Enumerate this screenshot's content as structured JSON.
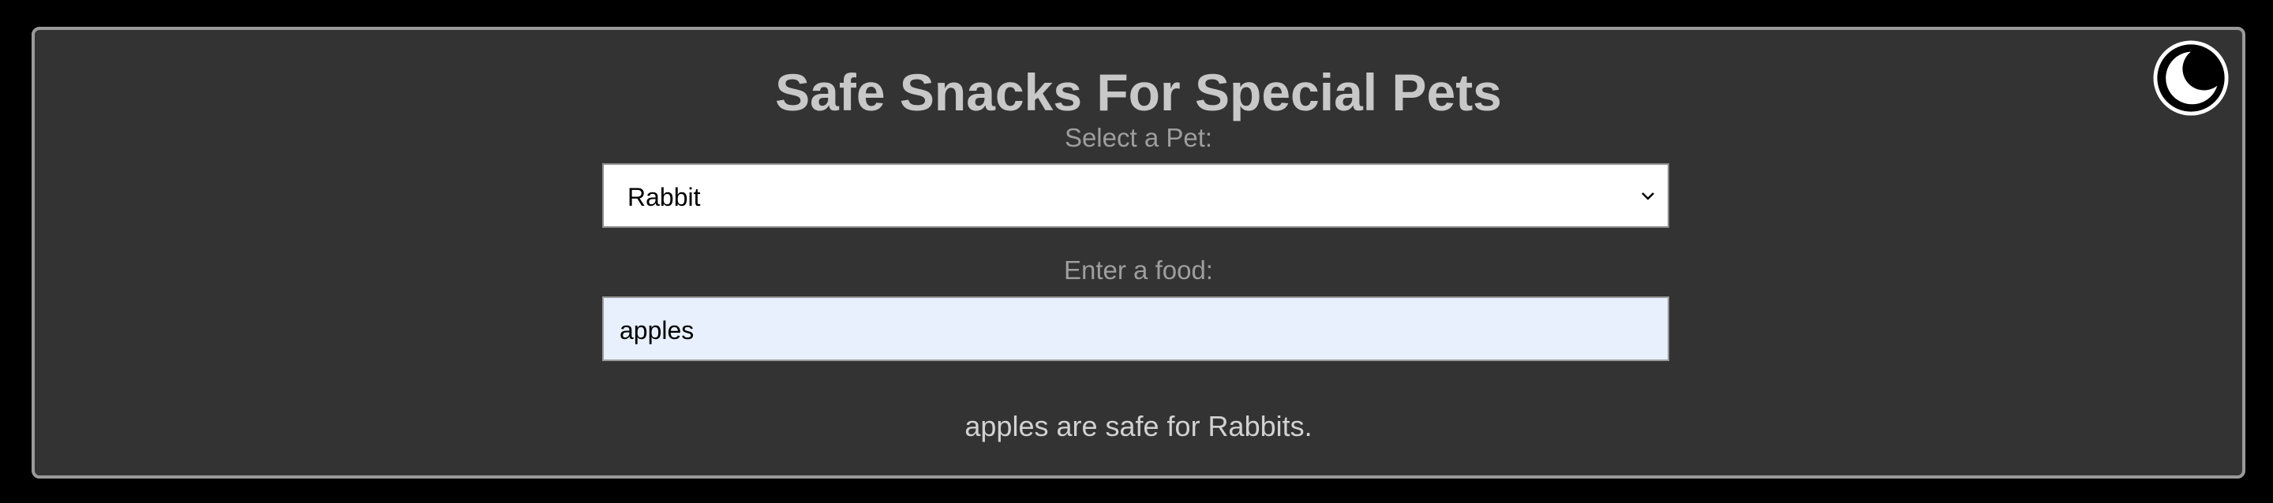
{
  "header": {
    "title": "Safe Snacks For Special Pets"
  },
  "pet_select": {
    "label": "Select a Pet:",
    "selected_value": "Rabbit"
  },
  "food_input": {
    "label": "Enter a food:",
    "value": "apples"
  },
  "result": {
    "message": "apples are safe for Rabbits."
  },
  "theme_toggle": {
    "icon": "moon-icon"
  },
  "colors": {
    "page_background": "#000000",
    "panel_background": "#333333",
    "panel_border": "#9a9a9a",
    "title_text": "#c8c8c8",
    "label_text": "#9e9e9e",
    "input_autofill_background": "#e8f0fe"
  }
}
